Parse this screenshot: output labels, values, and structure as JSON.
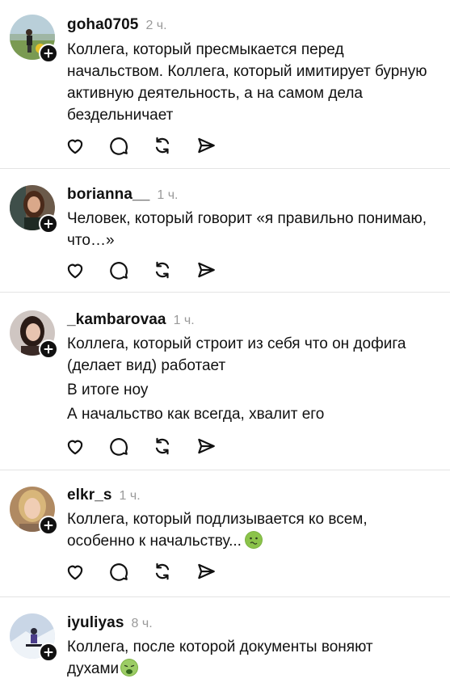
{
  "posts": [
    {
      "username": "goha0705",
      "time": "2 ч.",
      "paragraphs": [
        "Коллега, который пресмыкается перед начальством. Коллега, который имитирует бурную активную деятельность, а на самом дела бездельничает"
      ],
      "emoji": ""
    },
    {
      "username": "borianna__",
      "time": "1 ч.",
      "paragraphs": [
        "Человек, который говорит «я правильно понимаю, что…»"
      ],
      "emoji": ""
    },
    {
      "username": "_kambarovaa",
      "time": "1 ч.",
      "paragraphs": [
        "Коллега, который строит из себя что он дофига (делает вид) работает",
        "В итоге ноу",
        "А начальство как всегда, хвалит его"
      ],
      "emoji": ""
    },
    {
      "username": "elkr_s",
      "time": "1 ч.",
      "paragraphs": [
        "Коллега, который подлизывается ко всем, особенно к начальству..."
      ],
      "emoji": "nauseated-face-icon"
    },
    {
      "username": "iyuliyas",
      "time": "8 ч.",
      "paragraphs": [
        "Коллега, после которой документы воняют духами"
      ],
      "emoji": "vomiting-face-icon"
    }
  ],
  "icons": {
    "like": "heart-icon",
    "reply": "comment-bubble-icon",
    "repost": "repost-icon",
    "share": "send-icon",
    "follow": "plus-icon"
  },
  "colors": {
    "text": "#111111",
    "muted": "#9a9a9a",
    "divider": "#e4e4e4",
    "emoji_green": "#7cb342"
  }
}
